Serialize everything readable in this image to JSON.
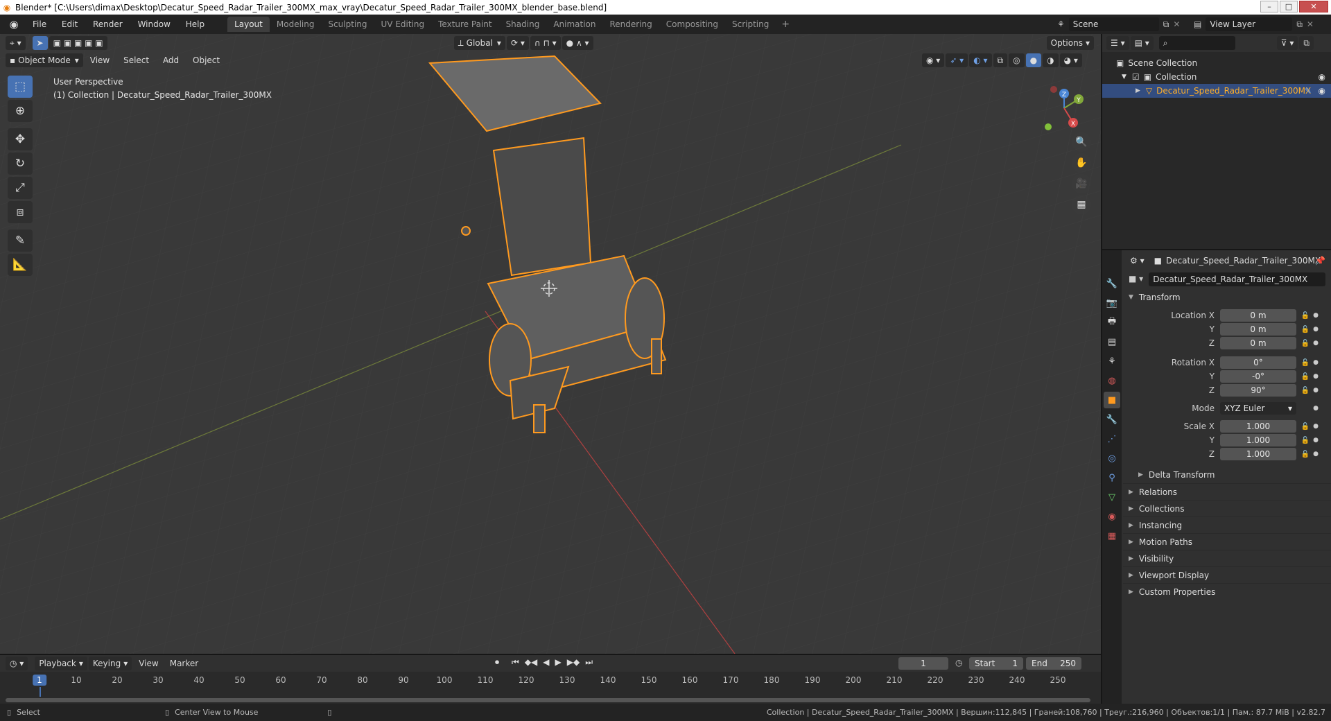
{
  "window": {
    "title": "Blender* [C:\\Users\\dimax\\Desktop\\Decatur_Speed_Radar_Trailer_300MX_max_vray\\Decatur_Speed_Radar_Trailer_300MX_blender_base.blend]",
    "minimize": "–",
    "maximize": "□",
    "close": "✕"
  },
  "topbar": {
    "menus": [
      "File",
      "Edit",
      "Render",
      "Window",
      "Help"
    ],
    "workspaces": [
      "Layout",
      "Modeling",
      "Sculpting",
      "UV Editing",
      "Texture Paint",
      "Shading",
      "Animation",
      "Rendering",
      "Compositing",
      "Scripting"
    ],
    "active_workspace": "Layout",
    "add_tab": "+",
    "scene": "Scene",
    "view_layer": "View Layer"
  },
  "viewport": {
    "mode": "Object Mode",
    "menus": [
      "View",
      "Select",
      "Add",
      "Object"
    ],
    "transform_orientation": "Global",
    "options": "Options",
    "info_line1": "User Perspective",
    "info_line2": "(1) Collection | Decatur_Speed_Radar_Trailer_300MX",
    "gizmo": {
      "z": "Z",
      "y": "Y",
      "x": "X"
    }
  },
  "outliner": {
    "scene_collection": "Scene Collection",
    "collection": "Collection",
    "object": "Decatur_Speed_Radar_Trailer_300MX"
  },
  "properties": {
    "header_object": "Decatur_Speed_Radar_Trailer_300MX",
    "object_name": "Decatur_Speed_Radar_Trailer_300MX",
    "transform_title": "Transform",
    "location_x_label": "Location X",
    "location_x": "0 m",
    "location_y_label": "Y",
    "location_y": "0 m",
    "location_z_label": "Z",
    "location_z": "0 m",
    "rotation_x_label": "Rotation X",
    "rotation_x": "0°",
    "rotation_y_label": "Y",
    "rotation_y": "-0°",
    "rotation_z_label": "Z",
    "rotation_z": "90°",
    "mode_label": "Mode",
    "mode": "XYZ Euler",
    "scale_x_label": "Scale X",
    "scale_x": "1.000",
    "scale_y_label": "Y",
    "scale_y": "1.000",
    "scale_z_label": "Z",
    "scale_z": "1.000",
    "delta_transform": "Delta Transform",
    "panels": [
      "Relations",
      "Collections",
      "Instancing",
      "Motion Paths",
      "Visibility",
      "Viewport Display",
      "Custom Properties"
    ]
  },
  "timeline": {
    "menus": [
      "Playback",
      "Keying",
      "View",
      "Marker"
    ],
    "current_frame": "1",
    "start_label": "Start",
    "start": "1",
    "end_label": "End",
    "end": "250",
    "ruler": [
      "1",
      "10",
      "20",
      "30",
      "40",
      "50",
      "60",
      "70",
      "80",
      "90",
      "100",
      "110",
      "120",
      "130",
      "140",
      "150",
      "160",
      "170",
      "180",
      "190",
      "200",
      "210",
      "220",
      "230",
      "240",
      "250"
    ]
  },
  "statusbar": {
    "left": "Select",
    "middle": "Center View to Mouse",
    "right": "Collection | Decatur_Speed_Radar_Trailer_300MX | Вершин:112,845 | Граней:108,760 | Треуг.:216,960 | Объектов:1/1 | Пам.: 87.7 MiB | v2.82.7"
  },
  "colors": {
    "selection_outline": "#ff9a1f",
    "accent_blue": "#4772b3",
    "viewport_bg": "#393939",
    "axis_x": "#c84a4a",
    "axis_y": "#7c9a3a"
  }
}
